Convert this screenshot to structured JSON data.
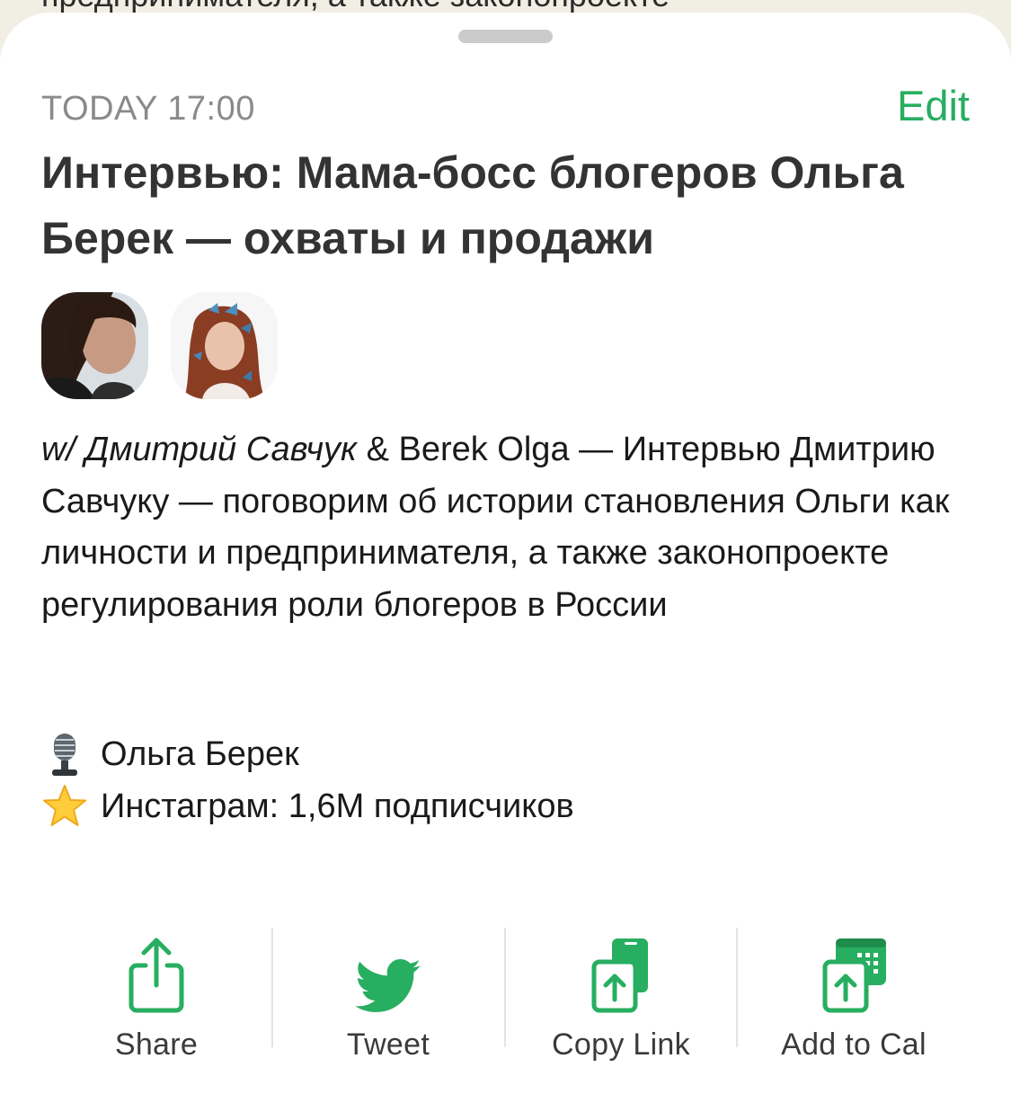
{
  "background_text": "предпринимателя, а также законопроекте",
  "header": {
    "date": "TODAY 17:00",
    "edit_label": "Edit"
  },
  "event": {
    "title": "Интервью: Мама-босс блогеров Ольга Берек — охваты и продажи",
    "hosts": [
      {
        "name": "Дмитрий Савчук"
      },
      {
        "name": "Berek Olga"
      }
    ],
    "description": {
      "prefix": "w/ ",
      "host_1": "Дмитрий Савчук",
      "joiner": " & ",
      "host_2": "Berek Olga",
      "text": " — Интервью Дмитрию Савчуку — поговорим об истории становления Ольги как личности и предпринимателя, а также законопроекте регулирования роли блогеров в России"
    },
    "facts": [
      {
        "icon": "microphone-icon",
        "text": "Ольга Берек"
      },
      {
        "icon": "star-icon",
        "text": "Инстаграм: 1,6М подписчиков"
      }
    ]
  },
  "actions": [
    {
      "icon": "share-icon",
      "label": "Share"
    },
    {
      "icon": "twitter-bird-icon",
      "label": "Tweet"
    },
    {
      "icon": "copy-link-icon",
      "label": "Copy Link"
    },
    {
      "icon": "add-to-calendar-icon",
      "label": "Add to Cal"
    }
  ],
  "colors": {
    "accent": "#27ae60",
    "title": "#333333",
    "muted": "#8a8a8a"
  }
}
